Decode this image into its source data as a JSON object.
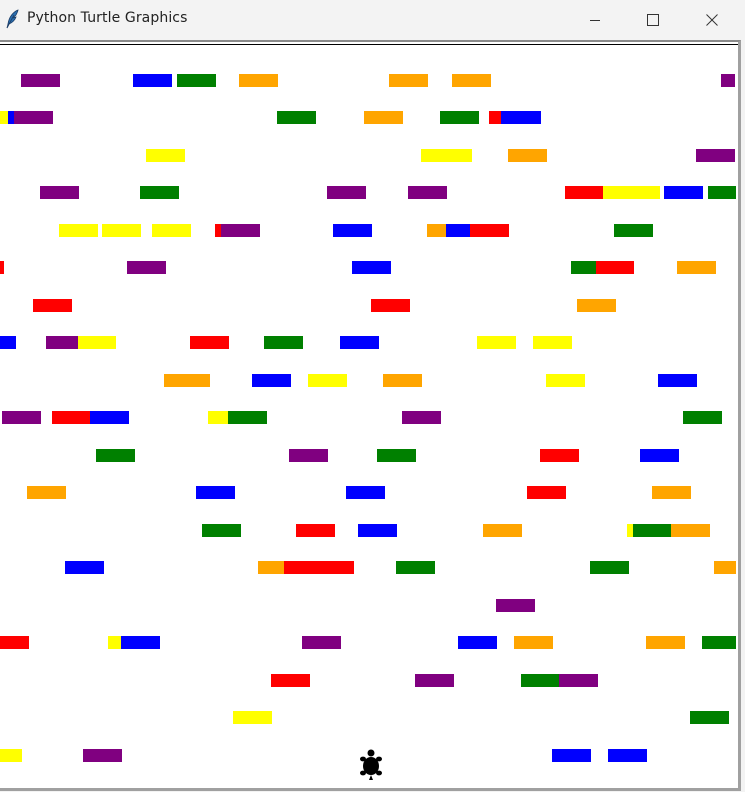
{
  "window": {
    "title": "Python Turtle Graphics",
    "controls": [
      "minimize",
      "maximize",
      "close"
    ]
  },
  "canvas": {
    "background": "#ffffff"
  },
  "colors": {
    "red": "#ff0000",
    "blue": "#0000ff",
    "green": "#008000",
    "orange": "#ffa500",
    "yellow": "#ffff00",
    "purple": "#800080"
  },
  "turtle": {
    "shape": "turtle-icon",
    "color": "#000000"
  }
}
